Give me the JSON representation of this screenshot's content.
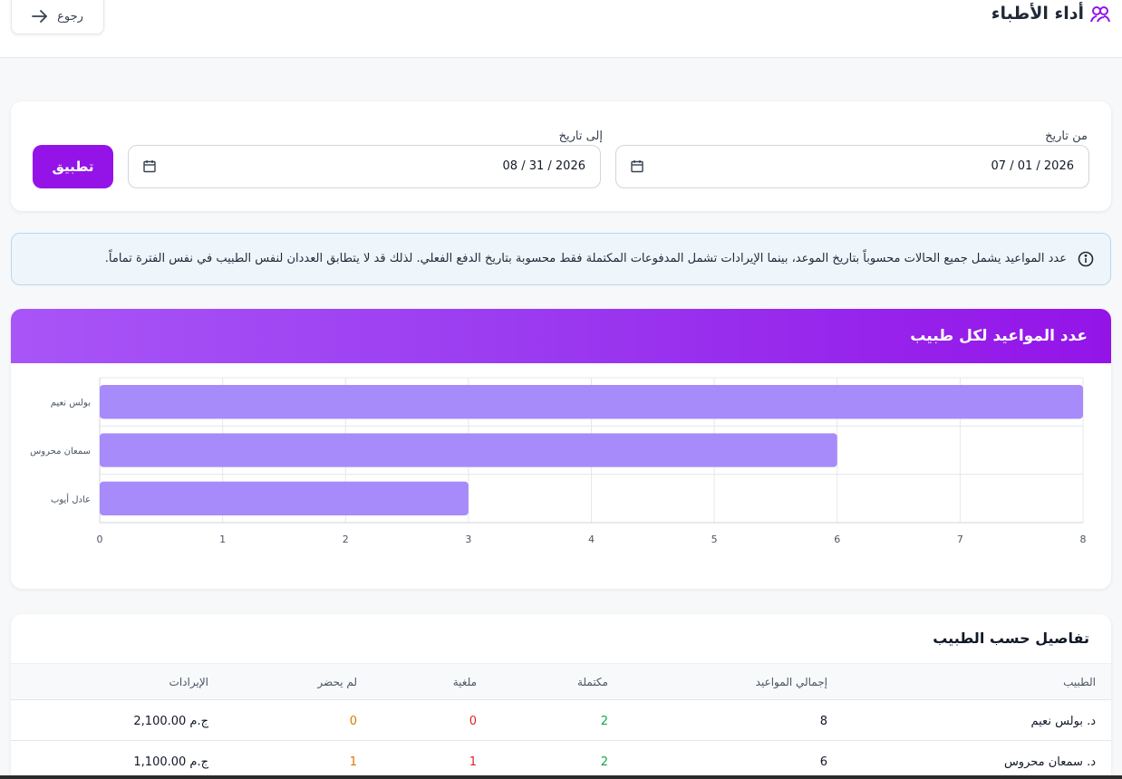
{
  "header": {
    "title": "أداء الأطباء",
    "back_label": "رجوع"
  },
  "filters": {
    "from_label": "من تاريخ",
    "from_value": "07 / 01 / 2026",
    "to_label": "إلى تاريخ",
    "to_value": "08 / 31 / 2026",
    "apply_label": "تطبيق"
  },
  "info": {
    "text": "عدد المواعيد يشمل جميع الحالات محسوباً بتاريخ الموعد، بينما الإيرادات تشمل المدفوعات المكتملة فقط محسوبة بتاريخ الدفع الفعلي. لذلك قد لا يتطابق العددان لنفس الطبيب في نفس الفترة تماماً."
  },
  "chart_section": {
    "title": "عدد المواعيد لكل طبيب"
  },
  "chart_data": {
    "type": "bar",
    "orientation": "horizontal",
    "categories": [
      "بولس نعيم",
      "سمعان محروس",
      "عادل أيوب"
    ],
    "values": [
      8,
      6,
      3
    ],
    "xlim": [
      0,
      8
    ],
    "xticks": [
      0,
      1,
      2,
      3,
      4,
      5,
      6,
      7,
      8
    ],
    "grid": true,
    "bar_color": "#a78bfa"
  },
  "details": {
    "title": "تفاصيل حسب الطبيب",
    "columns": [
      "الطبيب",
      "إجمالي المواعيد",
      "مكتملة",
      "ملغية",
      "لم يحضر",
      "الإيرادات"
    ],
    "rows": [
      {
        "doctor": "د. بولس نعيم",
        "total": "8",
        "completed": "2",
        "cancelled": "0",
        "no_show": "0",
        "revenue": "2,100.00 ج.م"
      },
      {
        "doctor": "د. سمعان محروس",
        "total": "6",
        "completed": "2",
        "cancelled": "1",
        "no_show": "1",
        "revenue": "1,100.00 ج.م"
      }
    ]
  },
  "colors": {
    "accent": "#9414e8",
    "completed": "#16a34a",
    "cancelled": "#dc2626",
    "no_show": "#d97706"
  }
}
